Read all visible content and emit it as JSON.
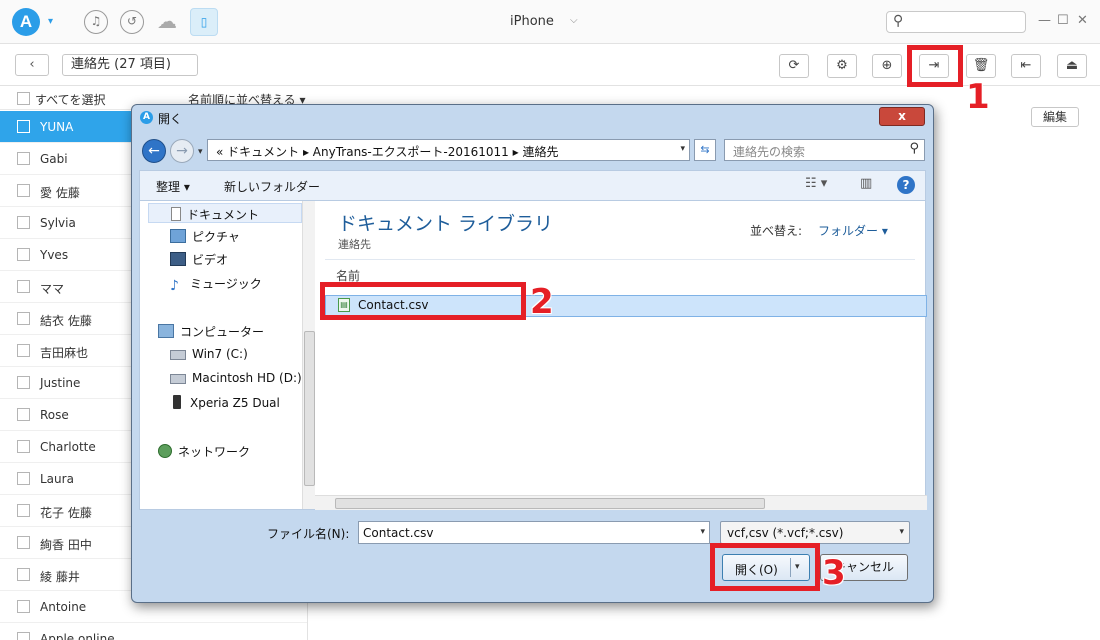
{
  "app": {
    "logo_letter": "A",
    "device_title": "iPhone",
    "colors": {
      "accent": "#2b9de8",
      "highlight_red": "#e51f26",
      "selected_row": "#2fa4ea"
    }
  },
  "toolbar": {
    "category_select": "連絡先 (27 項目)",
    "edit_label": "編集"
  },
  "list": {
    "select_all": "すべてを選択",
    "sort_label": "名前順に並べ替える",
    "contacts": [
      "YUNA",
      "Gabi",
      "愛 佐藤",
      "Sylvia",
      "Yves",
      "ママ",
      "結衣 佐藤",
      "吉田麻也",
      "Justine",
      "Rose",
      "Charlotte",
      "Laura",
      "花子 佐藤",
      "絢香 田中",
      "綾 藤井",
      "Antoine",
      "Apple online"
    ],
    "selected_index": 0
  },
  "dialog": {
    "title": "開く",
    "close": "x",
    "address": "« ドキュメント ▸ AnyTrans-エクスポート-20161011 ▸ 連絡先",
    "search_placeholder": "連絡先の検索",
    "organize": "整理 ▾",
    "new_folder": "新しいフォルダー",
    "nav": {
      "documents": "ドキュメント",
      "pictures": "ピクチャ",
      "videos": "ビデオ",
      "music": "ミュージック",
      "computer": "コンピューター",
      "win7": "Win7 (C:)",
      "macintosh": "Macintosh HD (D:)",
      "xperia": "Xperia Z5 Dual",
      "network": "ネットワーク"
    },
    "library_title": "ドキュメント ライブラリ",
    "library_sub": "連絡先",
    "arrange_label": "並べ替え:",
    "arrange_value": "フォルダー ▾",
    "column_name": "名前",
    "file": "Contact.csv",
    "filename_label": "ファイル名(N):",
    "filename_value": "Contact.csv",
    "filetype": "vcf,csv (*.vcf;*.csv)",
    "open_button": "開く(O)",
    "cancel_button": "キャンセル"
  },
  "annotations": {
    "step1": "1",
    "step2": "2",
    "step3": "3"
  }
}
